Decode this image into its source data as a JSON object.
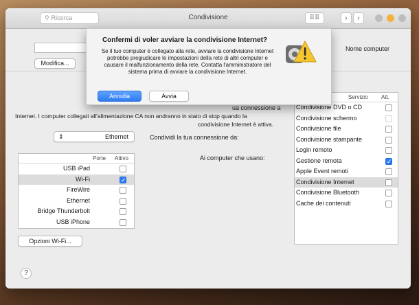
{
  "window": {
    "title": "Condivisione",
    "search_placeholder": "Ricerca",
    "grid_icon": "grid-icon",
    "nav_back": "‹",
    "nav_forward": "›"
  },
  "upper": {
    "computer_name_label": "Nome computer",
    "edit_button": "Modifica..."
  },
  "description": {
    "line1": "ua connessione a",
    "line2": "Internet. I computer collegati all'alimentazione CA non andranno in stato di stop quando la",
    "line3": "condivisione Internet è attiva."
  },
  "share_from": {
    "label": "Condividi la tua connessione da:",
    "value": "Ethernet"
  },
  "to_computers_label": "Ai computer che usano:",
  "ports": {
    "col_active": "Attivo",
    "col_ports": "Porte",
    "rows": [
      {
        "name": "USB iPad",
        "checked": false
      },
      {
        "name": "Wi-Fi",
        "checked": true
      },
      {
        "name": "FireWire",
        "checked": false
      },
      {
        "name": "Ethernet",
        "checked": false
      },
      {
        "name": "Bridge Thunderbolt",
        "checked": false
      },
      {
        "name": "USB iPhone",
        "checked": false
      }
    ]
  },
  "wifi_options_button": "Opzioni Wi-Fi...",
  "services": {
    "col_on": "Att.",
    "col_service": "Servizio",
    "rows": [
      {
        "name": "Condivisione DVD o CD",
        "checked": false,
        "dim": false
      },
      {
        "name": "Condivisione schermo",
        "checked": false,
        "dim": true
      },
      {
        "name": "Condivisione file",
        "checked": false,
        "dim": false
      },
      {
        "name": "Condivisione stampante",
        "checked": false,
        "dim": false
      },
      {
        "name": "Login remoto",
        "checked": false,
        "dim": false
      },
      {
        "name": "Gestione remota",
        "checked": true,
        "dim": false
      },
      {
        "name": "Apple Event remoti",
        "checked": false,
        "dim": false
      },
      {
        "name": "Condivisione Internet",
        "checked": false,
        "dim": false
      },
      {
        "name": "Condivisione Bluetooth",
        "checked": false,
        "dim": false
      },
      {
        "name": "Cache dei contenuti",
        "checked": false,
        "dim": false
      }
    ]
  },
  "dialog": {
    "title": "Confermi di voler avviare la condivisione Internet?",
    "body": "Se il tuo computer è collegato alla rete, avviare la condivisione Internet potrebbe pregiudicare le impostazioni della rete di altri computer e causare il malfunzionamento della rete. Contatta l'amministratore del sistema prima di avviare la condivisione Internet.",
    "start_button": "Avvia",
    "cancel_button": "Annulla",
    "icon": "warning-icon"
  },
  "help_label": "?"
}
